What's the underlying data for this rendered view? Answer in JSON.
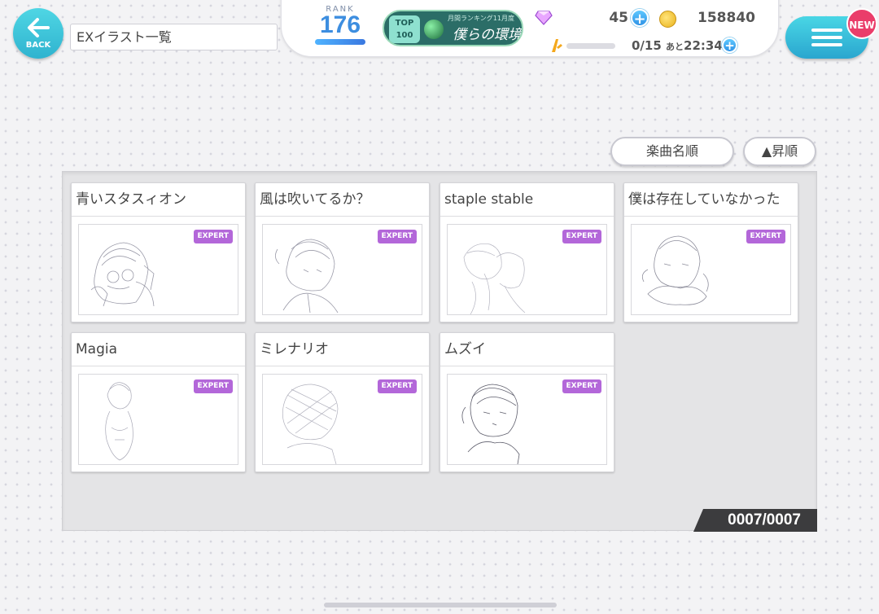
{
  "header": {
    "back_label": "BACK",
    "page_title": "EXイラスト一覧",
    "rank_label": "RANK",
    "rank_value": "176",
    "event": {
      "top_label": "TOP 100",
      "subtitle": "月間ランキング11月度",
      "name": "僕らの環境"
    },
    "gems": "45",
    "coins": "158840",
    "stamina": "0/15",
    "stamina_time_prefix": "あと",
    "stamina_time": "22:34",
    "new_badge": "NEW"
  },
  "sort": {
    "order_label": "楽曲名順",
    "direction_label": "▲昇順"
  },
  "cards": [
    {
      "title": "青いスタスィオン",
      "badge": "EXPERT",
      "sketch": "sketch-blue-station"
    },
    {
      "title": "風は吹いてるか？",
      "badge": "EXPERT",
      "sketch": "sketch-kaze"
    },
    {
      "title": "staple stable",
      "badge": "EXPERT",
      "sketch": "sketch-staple"
    },
    {
      "title": "僕は存在していなかった",
      "badge": "EXPERT",
      "sketch": "sketch-boku"
    },
    {
      "title": "Magia",
      "badge": "EXPERT",
      "sketch": "sketch-magia"
    },
    {
      "title": "ミレナリオ",
      "badge": "EXPERT",
      "sketch": "sketch-millenario"
    },
    {
      "title": "ムズイ",
      "badge": "EXPERT",
      "sketch": "sketch-muzui"
    }
  ],
  "counter": "0007/0007",
  "colors": {
    "accent": "#2fb3cf",
    "expert_badge": "#b367d9",
    "new_badge": "#ea3d6a"
  }
}
